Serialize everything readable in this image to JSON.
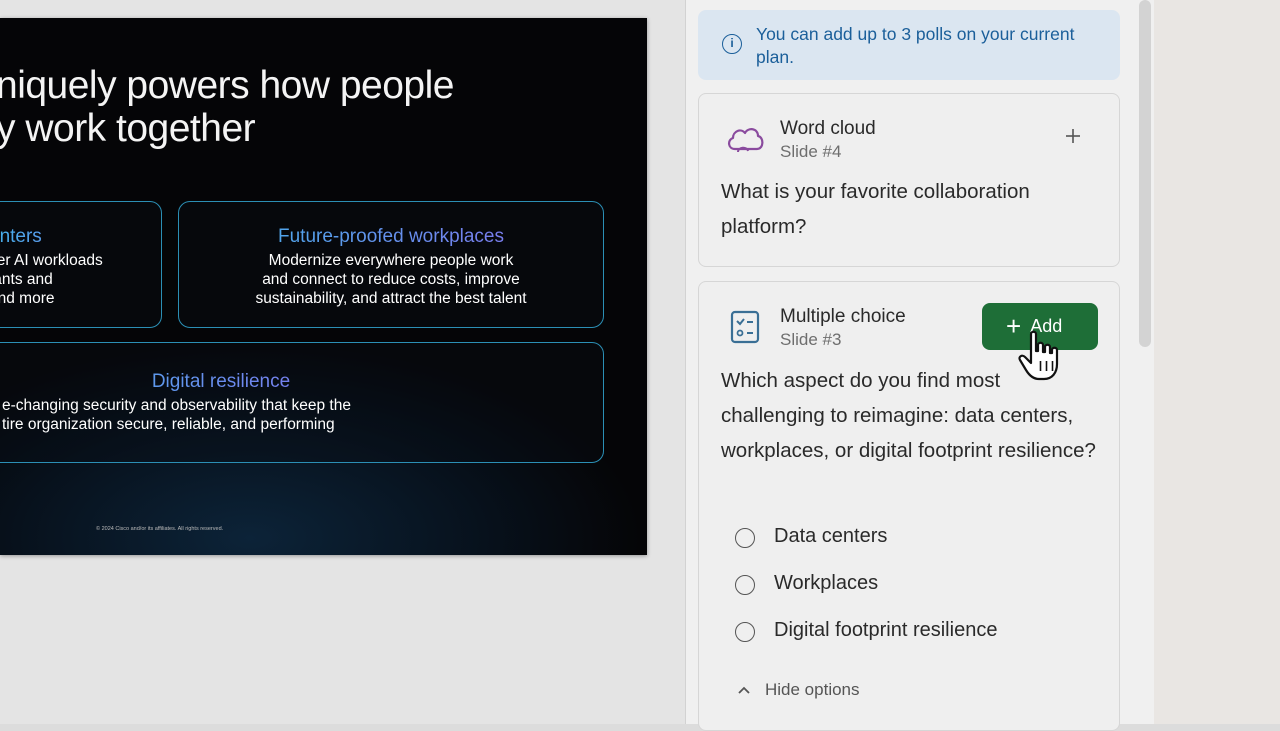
{
  "slide": {
    "title": "niquely powers how people\ny work together",
    "cards": [
      {
        "title": "enters",
        "body": "ver AI workloads\ntants and\nand more"
      },
      {
        "title": "Future-proofed workplaces",
        "body": "Modernize everywhere people work\nand connect to reduce costs, improve\nsustainability, and attract the best talent"
      },
      {
        "title": "Digital resilience",
        "body": "e-changing security and observability that keep the\ntire organization secure, reliable, and performing"
      }
    ],
    "footer": "© 2024 Cisco and/or its affiliates. All rights reserved."
  },
  "panel": {
    "info_text": "You can add up to 3 polls on your current plan.",
    "polls": [
      {
        "type": "Word cloud",
        "slide": "Slide #4",
        "question": "What is your favorite collaboration platform?",
        "icon": "cloud-icon"
      },
      {
        "type": "Multiple choice",
        "slide": "Slide #3",
        "question": "Which aspect do you find most challenging to reimagine: data centers, workplaces, or digital footprint resilience?",
        "icon": "checklist-icon",
        "add_label": "Add",
        "options": [
          "Data centers",
          "Workplaces",
          "Digital footprint resilience"
        ],
        "hide_options_label": "Hide options"
      }
    ]
  },
  "colors": {
    "add_button": "#1e6e37",
    "info_banner_bg": "#dbe6f1",
    "info_text": "#1b5f9a",
    "card_border": "#2b8fb5",
    "wordcloud_icon": "#8a4b9e",
    "checklist_icon": "#3a6f95"
  }
}
